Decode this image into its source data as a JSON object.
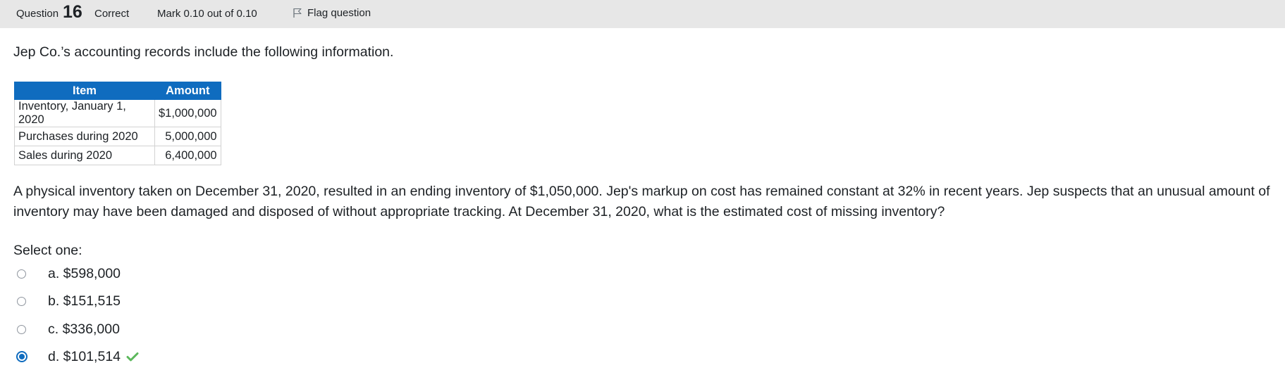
{
  "header": {
    "question_label": "Question",
    "question_number": "16",
    "state": "Correct",
    "grade": "Mark 0.10 out of 0.10",
    "flag_label": "Flag question"
  },
  "question": {
    "intro": "Jep Co.’s accounting records include the following information.",
    "table": {
      "headers": [
        "Item",
        "Amount"
      ],
      "rows": [
        [
          "Inventory, January 1, 2020",
          "$1,000,000"
        ],
        [
          "Purchases during 2020",
          "5,000,000"
        ],
        [
          "Sales during 2020",
          "6,400,000"
        ]
      ]
    },
    "body": "A physical inventory taken on December 31, 2020, resulted in an ending inventory of $1,050,000. Jep's markup on cost has remained constant at 32% in recent years. Jep suspects that an unusual amount of inventory may have been damaged and disposed of without appropriate tracking. At December 31, 2020, what is the estimated cost of missing inventory?",
    "prompt": "Select one:",
    "options": [
      {
        "label": "a. $598,000",
        "selected": false
      },
      {
        "label": "b. $151,515",
        "selected": false
      },
      {
        "label": "c. $336,000",
        "selected": false
      },
      {
        "label": "d. $101,514",
        "selected": true,
        "correct": true
      }
    ]
  },
  "colors": {
    "accent": "#0f6cbf",
    "correct": "#5cb85c",
    "header_bg": "#e7e7e7"
  },
  "icons": {
    "flag": "flag-icon",
    "correct": "check-icon"
  }
}
